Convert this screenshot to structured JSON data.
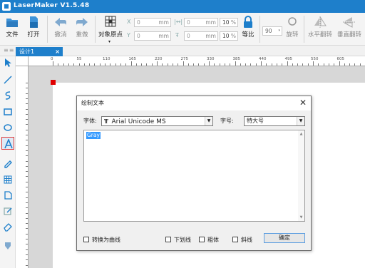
{
  "app": {
    "title": "LaserMaker V1.5.48"
  },
  "toolbar": {
    "file_label": "文件",
    "open_label": "打开",
    "undo_label": "撤消",
    "redo_label": "重做",
    "origin_label": "对象原点",
    "x_label": "X",
    "y_label": "Y",
    "x_value": "0",
    "y_value": "0",
    "w_value": "0",
    "h_value": "0",
    "unit_mm": "mm",
    "pct_w": "10",
    "pct_h": "10",
    "unit_pct": "%",
    "lock_ratio_label": "等比",
    "rotation_value": "90",
    "rotate_label": "旋转",
    "flip_h_label": "水平翻转",
    "flip_v_label": "垂直翻转"
  },
  "tabs": [
    {
      "label": "设计1"
    }
  ],
  "ruler": {
    "h_ticks": [
      "0",
      "55",
      "110",
      "165",
      "220",
      "275",
      "330",
      "385",
      "440",
      "495",
      "550",
      "605"
    ]
  },
  "dialog": {
    "title": "绘制文本",
    "font_label": "字体:",
    "font_value": "Arial Unicode MS",
    "size_label": "字号:",
    "size_value": "特大号",
    "text_content": "Gray",
    "convert_label": "转换为曲线",
    "underline_label": "下划线",
    "bold_label": "粗体",
    "italic_label": "斜线",
    "ok_label": "确定"
  },
  "colors": {
    "accent": "#1e7fcb",
    "selected_tool": "#e03a3a",
    "origin_marker": "#e00000"
  }
}
